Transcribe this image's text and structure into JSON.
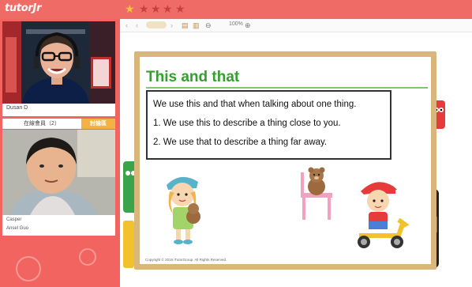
{
  "brand": "tutorJr",
  "rating": {
    "filled": 1,
    "total": 5
  },
  "colors": {
    "accent": "#ef6b66",
    "star_filled": "#f5c342",
    "star_empty": "#c8403d",
    "title_green": "#32a02c",
    "tab_active": "#f3b243"
  },
  "teacher": {
    "name": "Dusan D"
  },
  "tabs": {
    "attendees": "在線會員（2）",
    "discussion": "討論區"
  },
  "student": {
    "name": "Casper",
    "name2": "Ansel Guo"
  },
  "toolbar": {
    "icons": [
      "prev-icon",
      "page-indicator",
      "next-icon",
      "document-icon",
      "document-pages-icon",
      "zoom-out-icon",
      "zoom-in-icon"
    ],
    "zoom": "100%"
  },
  "watermark": "tutorJr",
  "slide": {
    "title": "This and that",
    "intro": "We use this and that when talking about one thing.",
    "points": [
      "1.  We use this to describe a thing close to you.",
      "2.  We use that to describe a thing far away."
    ],
    "copyright": "Copyright © 2016 iTutorGroup. All Rights Reserved."
  }
}
